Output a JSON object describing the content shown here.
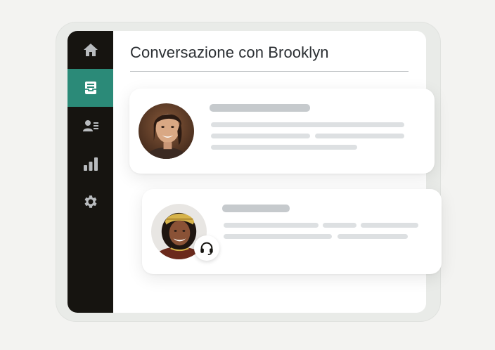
{
  "window": {
    "title": "Conversazione con Brooklyn"
  },
  "sidebar": {
    "items": [
      {
        "icon": "home-icon",
        "active": false
      },
      {
        "icon": "inbox-icon",
        "active": true
      },
      {
        "icon": "contacts-icon",
        "active": false
      },
      {
        "icon": "bar-chart-icon",
        "active": false
      },
      {
        "icon": "gear-icon",
        "active": false
      }
    ]
  },
  "colors": {
    "sidebar_bg": "#161410",
    "accent": "#2b8a78",
    "placeholder_head": "#c6cacd",
    "placeholder_line": "#dde0e2"
  },
  "messages": [
    {
      "sender": "customer",
      "avatar": "customer-avatar"
    },
    {
      "sender": "agent",
      "avatar": "agent-avatar",
      "badge": "headset-icon"
    }
  ]
}
